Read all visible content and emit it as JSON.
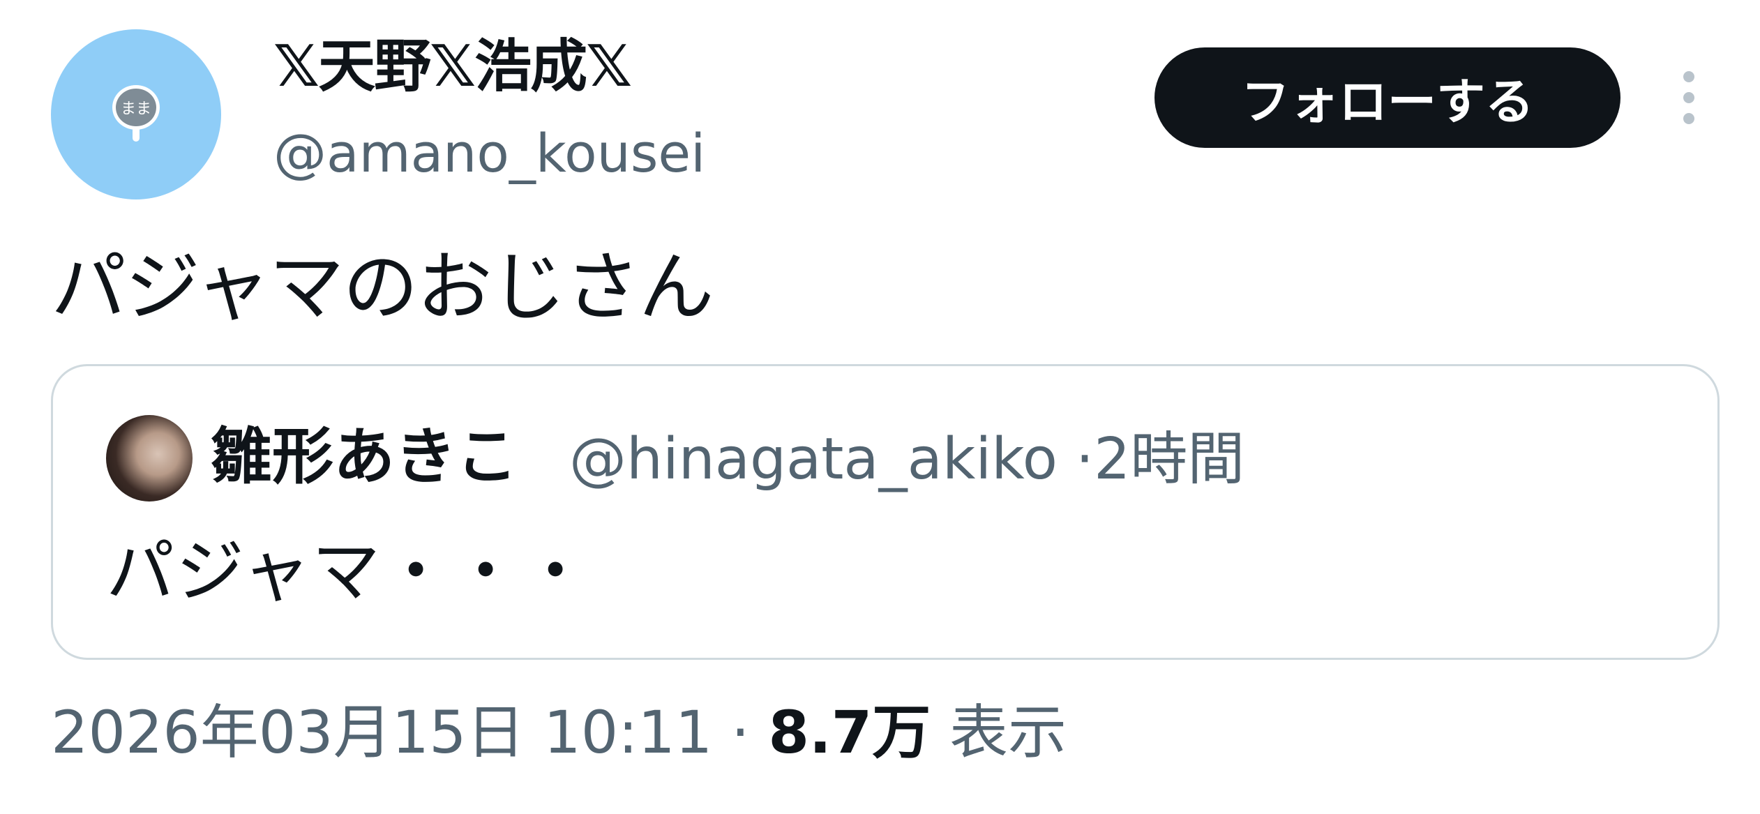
{
  "author": {
    "avatar_badge_text": "まま",
    "display_name": "𝕏天野𝕏浩成𝕏",
    "handle": "@amano_kousei"
  },
  "actions": {
    "follow_label": "フォローする",
    "more_icon": "more-vertical-icon"
  },
  "tweet": {
    "text": "パジャマのおじさん"
  },
  "quote": {
    "display_name": "雛形あきこ",
    "handle": "@hinagata_akiko",
    "separator": "·",
    "time": "2時間",
    "text": "パジャマ・・・"
  },
  "footer": {
    "timestamp": "2026年03月15日 10:11",
    "separator": "·",
    "views_count": "8.7万",
    "views_label": "表示"
  },
  "colors": {
    "avatar_bg": "#8fcdf7",
    "follow_bg": "#0f1419",
    "secondary_text": "#536471",
    "border": "#cfd9de"
  }
}
